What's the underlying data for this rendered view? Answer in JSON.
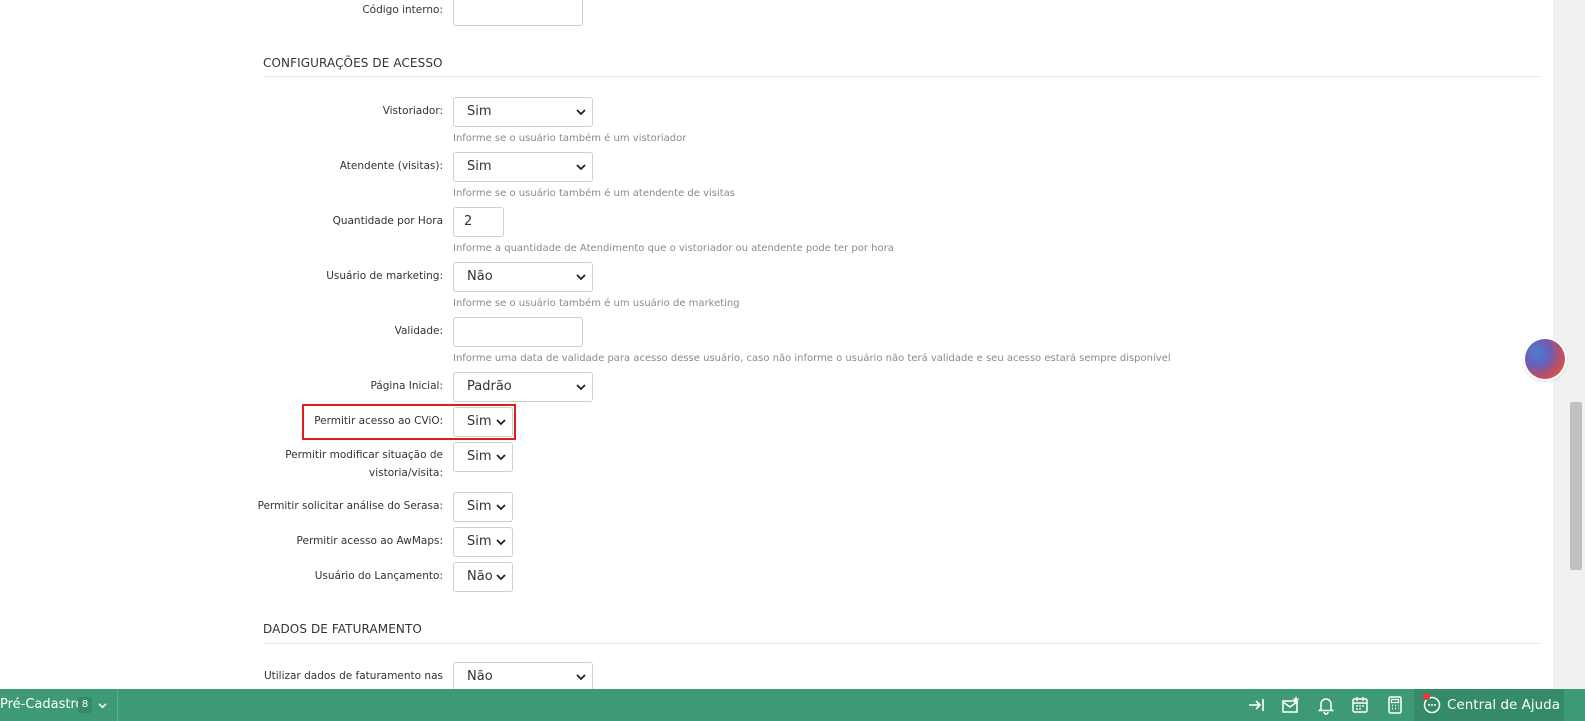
{
  "form": {
    "codigo_interno": {
      "label": "Código interno:",
      "value": ""
    },
    "section_acesso": "CONFIGURAÇÕES DE ACESSO",
    "vistoriador": {
      "label": "Vistoriador:",
      "value": "Sim",
      "help": "Informe se o usuário também é um vistoriador"
    },
    "atendente": {
      "label": "Atendente (visitas):",
      "value": "Sim",
      "help": "Informe se o usuário também é um atendente de visitas"
    },
    "quantidade": {
      "label": "Quantidade por Hora",
      "value": "2",
      "help": "Informe a quantidade de Atendimento que o vistoriador ou atendente pode ter por hora"
    },
    "marketing": {
      "label": "Usuário de marketing:",
      "value": "Não",
      "help": "Informe se o usuário também é um usuário de marketing"
    },
    "validade": {
      "label": "Validade:",
      "value": "",
      "help": "Informe uma data de validade para acesso desse usuário, caso não informe o usuário não terá validade e seu acesso estará sempre disponível"
    },
    "pagina_inicial": {
      "label": "Página Inicial:",
      "value": "Padrão"
    },
    "cvio": {
      "label": "Permitir acesso ao CViO:",
      "value": "Sim"
    },
    "modificar": {
      "label_line1": "Permitir modificar situação de",
      "label_line2": "vistoria/visita:",
      "value": "Sim"
    },
    "serasa": {
      "label": "Permitir solicitar análise do Serasa:",
      "value": "Sim"
    },
    "awmaps": {
      "label": "Permitir acesso ao AwMaps:",
      "value": "Sim"
    },
    "lancamento": {
      "label": "Usuário do Lançamento:",
      "value": "Não"
    },
    "section_faturamento": "DADOS DE FATURAMENTO",
    "faturamento": {
      "label": "Utilizar dados de faturamento nas",
      "value": "Não"
    }
  },
  "bottom_bar": {
    "pre_cadastro_label": "Pré-Cadastro",
    "pre_cadastro_count": "8",
    "help_label": "Central de Ajuda",
    "icons": [
      "collapse-arrow-icon",
      "mail-star-icon",
      "bell-icon",
      "calendar-icon",
      "calculator-icon",
      "chat-icon"
    ]
  },
  "colors": {
    "accent": "#3e9a75",
    "highlight": "#e11d1d"
  }
}
